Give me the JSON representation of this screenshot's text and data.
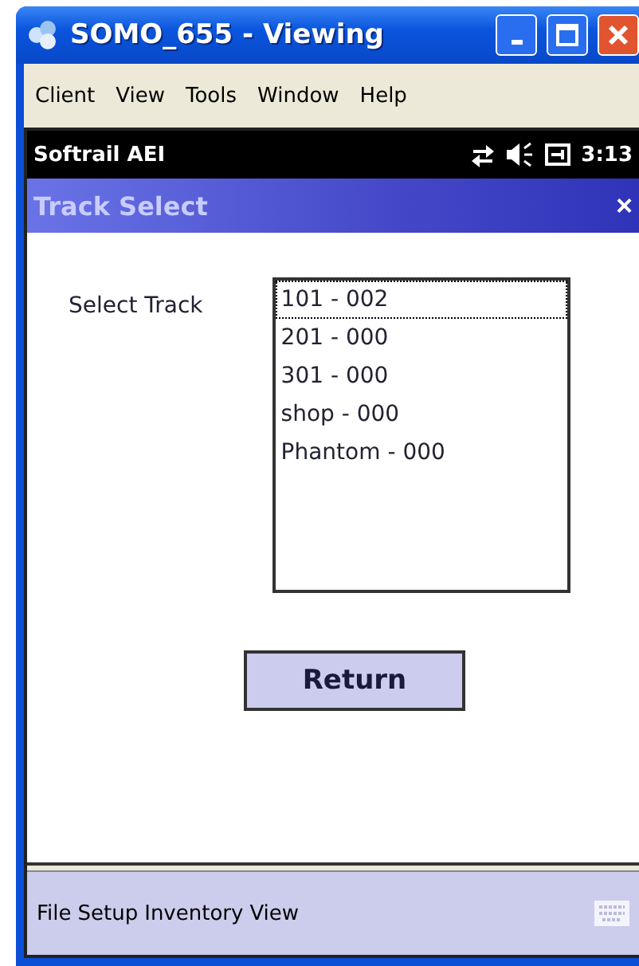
{
  "window": {
    "title": "SOMO_655 - Viewing"
  },
  "menu": [
    "Client",
    "View",
    "Tools",
    "Window",
    "Help"
  ],
  "status_bar": {
    "title": "Softrail AEI",
    "time": "3:13"
  },
  "dialog": {
    "title": "Track Select",
    "close": "×",
    "label": "Select Track",
    "tracks": [
      {
        "label": "101 - 002",
        "selected": true
      },
      {
        "label": "201 - 000",
        "selected": false
      },
      {
        "label": "301 - 000",
        "selected": false
      },
      {
        "label": "shop - 000",
        "selected": false
      },
      {
        "label": "Phantom - 000",
        "selected": false
      }
    ],
    "button": "Return"
  },
  "bottom_menu": [
    "File",
    "Setup",
    "Inventory",
    "View"
  ]
}
